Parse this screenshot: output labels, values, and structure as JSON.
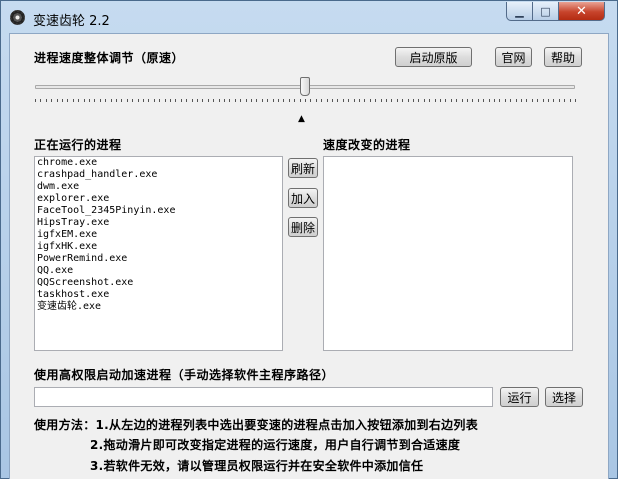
{
  "window": {
    "title": "变速齿轮 2.2",
    "min_glyph": "▁",
    "max_glyph": "□",
    "close_glyph": "✕"
  },
  "speed": {
    "label": "进程速度整体调节（原速）",
    "restore_button": "启动原版",
    "website_button": "官网",
    "help_button": "帮助",
    "pointer_glyph": "▲"
  },
  "slider": {
    "value_fraction": 0.5
  },
  "running": {
    "label": "正在运行的进程",
    "items": [
      "chrome.exe",
      "crashpad_handler.exe",
      "dwm.exe",
      "explorer.exe",
      "FaceTool_2345Pinyin.exe",
      "HipsTray.exe",
      "igfxEM.exe",
      "igfxHK.exe",
      "PowerRemind.exe",
      "QQ.exe",
      "QQScreenshot.exe",
      "taskhost.exe",
      "变速齿轮.exe"
    ]
  },
  "actions": {
    "refresh": "刷新",
    "add": "加入",
    "delete": "删除"
  },
  "changed": {
    "label": "速度改变的进程",
    "items": []
  },
  "launch": {
    "label": "使用高权限启动加速进程（手动选择软件主程序路径）",
    "path_value": "",
    "run_button": "运行",
    "choose_button": "选择"
  },
  "usage": {
    "line1": "使用方法：1.从左边的进程列表中选出要变速的进程点击加入按钮添加到右边列表",
    "line2": "2.拖动滑片即可改变指定进程的运行速度，用户自行调节到合适速度",
    "line3": "3.若软件无效，请以管理员权限运行并在安全软件中添加信任"
  }
}
